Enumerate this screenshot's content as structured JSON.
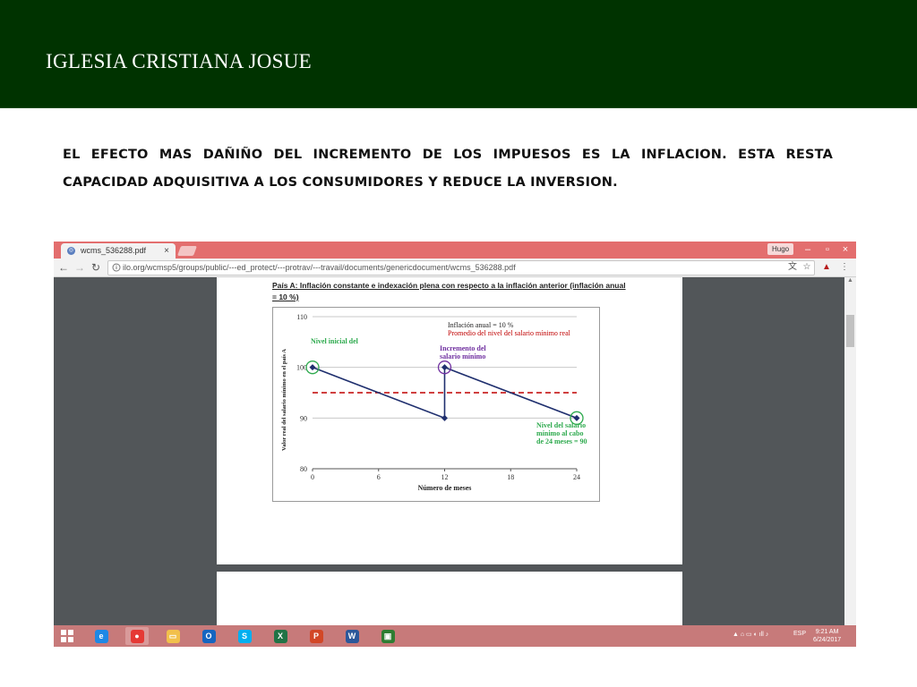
{
  "slide": {
    "title": "IGLESIA CRISTIANA JOSUE",
    "body": "EL EFECTO MAS DAÑIÑO DEL INCREMENTO DE LOS IMPUESOS ES LA INFLACION. ESTA RESTA CAPACIDAD ADQUISITIVA A LOS CONSUMIDORES Y REDUCE LA INVERSION.",
    "colors": {
      "header_bg": "#003300",
      "header_text": "#ffffff"
    }
  },
  "browser": {
    "tab_title": "wcms_536288.pdf",
    "tab_close": "×",
    "user": "Hugo",
    "window_controls": [
      "–",
      "▫",
      "×"
    ],
    "url": "ilo.org/wcmsp5/groups/public/---ed_protect/---protrav/---travail/documents/genericdocument/wcms_536288.pdf",
    "icons": [
      "back-arrow-icon",
      "forward-arrow-icon",
      "reload-icon",
      "page-info-icon",
      "translate-icon",
      "bookmark-star-icon",
      "pdf-extension-icon",
      "menu-dots-icon"
    ],
    "colors": {
      "tabbar": "#e36e6e",
      "viewer_bg": "#525659"
    }
  },
  "document": {
    "heading": "País A: Inflación constante e indexación plena con respecto a la inflación anterior (inflación anual = 10 %)"
  },
  "chart_data": {
    "type": "line",
    "xlabel": "Número de meses",
    "ylabel": "Valor real del salario mínimo en el país A",
    "x_ticks": [
      0,
      6,
      12,
      18,
      24
    ],
    "y_ticks": [
      80,
      90,
      100,
      110
    ],
    "xlim": [
      0,
      24
    ],
    "ylim": [
      80,
      110
    ],
    "grid": true,
    "series": [
      {
        "name": "Inflación anual = 10 %",
        "color": "#1f2f6e",
        "points": [
          [
            0,
            100
          ],
          [
            12,
            90
          ],
          [
            12,
            100
          ],
          [
            24,
            90
          ]
        ]
      },
      {
        "name": "Promedio del nivel del salario mínimo real",
        "color": "#c00000",
        "style": "dashed",
        "points": [
          [
            0,
            95
          ],
          [
            24,
            95
          ]
        ]
      }
    ],
    "annotations": [
      {
        "text": "Nivel inicial del",
        "color": "#2eaa4e",
        "x": 0,
        "y": 100
      },
      {
        "text": "Incremento del salario mínimo",
        "lines": [
          "Incremento del",
          "salario mínimo"
        ],
        "color": "#7030a0",
        "x": 12,
        "y": 100
      },
      {
        "text": "Nivel del salario mínimo al cabo de 24 meses = 90",
        "lines": [
          "Nivel del salario",
          "mínimo al cabo",
          "de 24 meses = 90"
        ],
        "color": "#2eaa4e",
        "x": 24,
        "y": 90
      }
    ]
  },
  "taskbar": {
    "apps": [
      {
        "name": "internet-explorer",
        "label": "e",
        "color": "#1e88e5"
      },
      {
        "name": "chrome",
        "label": "●",
        "color": "#e53935"
      },
      {
        "name": "file-explorer",
        "label": "▭",
        "color": "#f2c04b"
      },
      {
        "name": "outlook",
        "label": "O",
        "color": "#1565c0"
      },
      {
        "name": "skype",
        "label": "S",
        "color": "#00aff0"
      },
      {
        "name": "excel",
        "label": "X",
        "color": "#217346"
      },
      {
        "name": "powerpoint",
        "label": "P",
        "color": "#d24726"
      },
      {
        "name": "word",
        "label": "W",
        "color": "#2b579a"
      },
      {
        "name": "store",
        "label": "▣",
        "color": "#2e7d32"
      }
    ],
    "language": "ESP",
    "time": "9:21 AM",
    "date": "6/24/2017"
  }
}
